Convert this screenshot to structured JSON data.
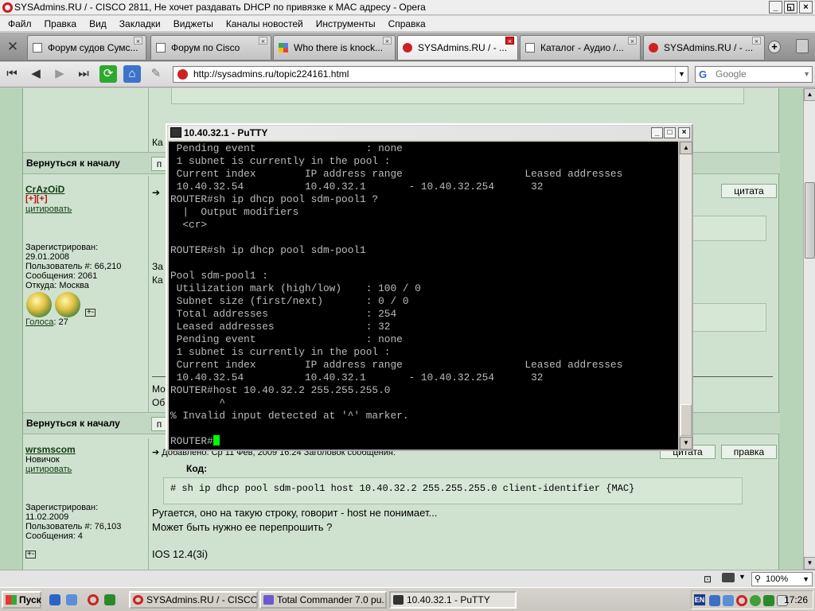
{
  "window": {
    "title": "SYSAdmins.RU / - CISCO 2811, Не хочет раздавать DHCP по привязке к MAC адресу - Opera",
    "buttons": [
      "_",
      "◱",
      "×"
    ]
  },
  "menu": [
    "Файл",
    "Правка",
    "Вид",
    "Закладки",
    "Виджеты",
    "Каналы новостей",
    "Инструменты",
    "Справка"
  ],
  "tabs": [
    {
      "label": "Форум судов Сумс...",
      "active": false
    },
    {
      "label": "Форум по Cisco",
      "active": false
    },
    {
      "label": "Who there is knock...",
      "active": false
    },
    {
      "label": "SYSAdmins.RU / - ...",
      "active": true
    },
    {
      "label": "Каталог - Аудио /...",
      "active": false
    },
    {
      "label": "SYSAdmins.RU / - ...",
      "active": false
    }
  ],
  "address": {
    "url": "http://sysadmins.ru/topic224161.html",
    "search_placeholder": "Google"
  },
  "forum": {
    "back_to_top": "Вернуться к началу",
    "cite": "цитата",
    "edit": "правка",
    "cite_link": "цитировать",
    "visible_fragments": {
      "ka1": "Ка",
      "za": "За",
      "ka2": "Ка",
      "mo": "Мо",
      "ob": "Об",
      "p1": "п",
      "p2": "п",
      "k1": "К"
    },
    "user1": {
      "name": "CrAzOiD",
      "rank": "[+][+]",
      "registered_label": "Зарегистрирован:",
      "registered": "29.01.2008",
      "user_no": "Пользователь #: 66,210",
      "messages": "Сообщения: 2061",
      "from": "Откуда: Москва",
      "votes_label": "Голоса",
      "votes": ": 27"
    },
    "user2": {
      "name": "wrsmscom",
      "rank": "Новичок",
      "registered_label": "Зарегистрирован:",
      "registered": "11.02.2009",
      "user_no": "Пользователь #: 76,103",
      "messages": "Сообщения: 4"
    },
    "post2": {
      "header": "Добавлено: Ср 11 Фев, 2009 16:24    Заголовок сообщения:",
      "code_label": "Код:",
      "code": "# sh ip dhcp pool sdm-pool1 host 10.40.32.2 255.255.255.0 client-identifier {MAC}",
      "line1": "Ругается, оно на такую строку, говорит - host не понимает...",
      "line2": "Может быть нужно ее перепрошить ?",
      "line3": "IOS 12.4(3i)"
    }
  },
  "putty": {
    "title": "10.40.32.1 - PuTTY",
    "lines": [
      " Pending event                  : none",
      " 1 subnet is currently in the pool :",
      " Current index        IP address range                    Leased addresses",
      " 10.40.32.54          10.40.32.1       - 10.40.32.254      32",
      "ROUTER#sh ip dhcp pool sdm-pool1 ?",
      "  |  Output modifiers",
      "  <cr>",
      "",
      "ROUTER#sh ip dhcp pool sdm-pool1",
      "",
      "Pool sdm-pool1 :",
      " Utilization mark (high/low)    : 100 / 0",
      " Subnet size (first/next)       : 0 / 0",
      " Total addresses                : 254",
      " Leased addresses               : 32",
      " Pending event                  : none",
      " 1 subnet is currently in the pool :",
      " Current index        IP address range                    Leased addresses",
      " 10.40.32.54          10.40.32.1       - 10.40.32.254      32",
      "ROUTER#host 10.40.32.2 255.255.255.0",
      "        ^",
      "% Invalid input detected at '^' marker.",
      ""
    ],
    "prompt": "ROUTER#"
  },
  "status": {
    "zoom": "100%"
  },
  "taskbar": {
    "start": "Пуск",
    "items": [
      {
        "label": "SYSAdmins.RU / - CISCO...",
        "active": false
      },
      {
        "label": "Total Commander 7.0 pu...",
        "active": false
      },
      {
        "label": "10.40.32.1 - PuTTY",
        "active": true
      }
    ],
    "lang": "EN",
    "clock": "17:26"
  },
  "colors": {
    "page_bg": "#cfe2cf",
    "terminal_bg": "#000000",
    "terminal_fg": "#bbbbbb",
    "cursor": "#00ff00",
    "active_tab_close": "#cc2020"
  }
}
